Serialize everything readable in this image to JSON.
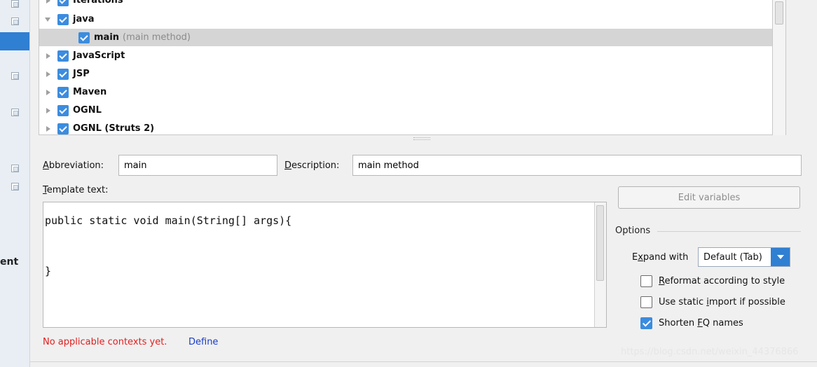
{
  "sidebar": {
    "partial_label": "ent"
  },
  "tree": {
    "items": [
      {
        "label": "Iterations",
        "sub": "",
        "expanded": false,
        "child": false,
        "selected": false
      },
      {
        "label": "java",
        "sub": "",
        "expanded": true,
        "child": false,
        "selected": false
      },
      {
        "label": "main",
        "sub": "(main method)",
        "expanded": false,
        "child": true,
        "selected": true
      },
      {
        "label": "JavaScript",
        "sub": "",
        "expanded": false,
        "child": false,
        "selected": false
      },
      {
        "label": "JSP",
        "sub": "",
        "expanded": false,
        "child": false,
        "selected": false
      },
      {
        "label": "Maven",
        "sub": "",
        "expanded": false,
        "child": false,
        "selected": false
      },
      {
        "label": "OGNL",
        "sub": "",
        "expanded": false,
        "child": false,
        "selected": false
      },
      {
        "label": "OGNL (Struts 2)",
        "sub": "",
        "expanded": false,
        "child": false,
        "selected": false
      }
    ]
  },
  "form": {
    "abbreviation_label_first": "A",
    "abbreviation_label_rest": "bbreviation:",
    "abbreviation_value": "main",
    "description_label_first": "D",
    "description_label_rest": "escription:",
    "description_value": "main method",
    "template_label_first": "T",
    "template_label_rest": "emplate text:",
    "code_lines": [
      "public static void main(String[] args){",
      "",
      "",
      "}"
    ]
  },
  "options": {
    "edit_variables_label": "Edit variables",
    "title": "Options",
    "expand_label_pre": "E",
    "expand_label_u": "x",
    "expand_label_post": "pand with",
    "expand_value": "Default (Tab)",
    "reformat_u": "R",
    "reformat_rest": "eformat according to style",
    "reformat_checked": false,
    "static_pre": "Use static ",
    "static_u": "i",
    "static_post": "mport if possible",
    "static_checked": false,
    "shorten_pre": "Shorten ",
    "shorten_u": "F",
    "shorten_post": "Q names",
    "shorten_checked": true
  },
  "footer": {
    "error_text": "No applicable contexts yet.",
    "define_link": "Define",
    "watermark": "https://blog.csdn.net/weixin_44376866"
  },
  "colors": {
    "accent": "#3b8cdf",
    "selection": "#d5d5d5",
    "error": "#e02020",
    "link": "#1a3cc8"
  }
}
